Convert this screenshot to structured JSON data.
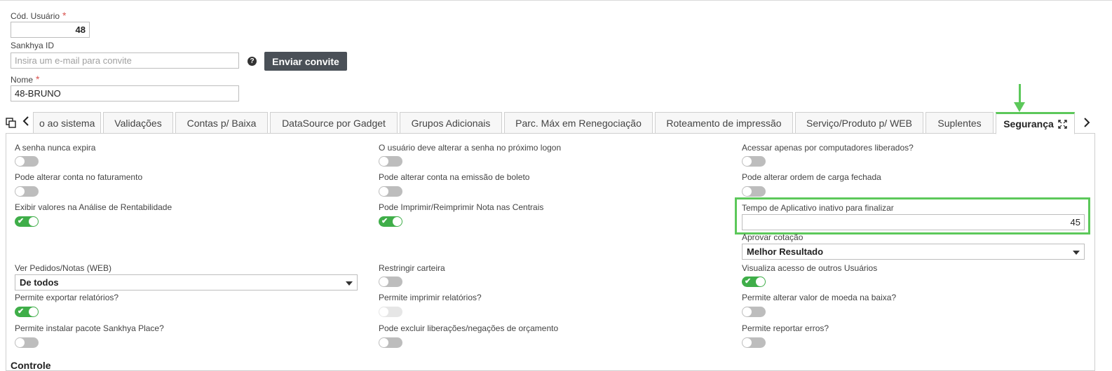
{
  "header": {
    "user_code_label": "Cód. Usuário",
    "user_code_value": "48",
    "sankhya_id_label": "Sankhya ID",
    "sankhya_id_placeholder": "Insira um e-mail para convite",
    "invite_button": "Enviar convite",
    "name_label": "Nome",
    "name_value": "48-BRUNO"
  },
  "tabs": [
    {
      "label": "Acesso ao sistema",
      "visible_text": "o ao sistema"
    },
    {
      "label": "Validações"
    },
    {
      "label": "Contas p/ Baixa"
    },
    {
      "label": "DataSource por Gadget"
    },
    {
      "label": "Grupos Adicionais"
    },
    {
      "label": "Parc. Máx em Renegociação"
    },
    {
      "label": "Roteamento de impressão"
    },
    {
      "label": "Serviço/Produto p/ WEB"
    },
    {
      "label": "Suplentes"
    },
    {
      "label": "Segurança",
      "active": true
    }
  ],
  "fields": {
    "c1r1": {
      "label": "A senha nunca expira",
      "on": false
    },
    "c2r1": {
      "label": "O usuário deve alterar a senha no próximo logon",
      "on": false
    },
    "c3r1": {
      "label": "Acessar apenas por computadores liberados?",
      "on": false
    },
    "c1r2": {
      "label": "Pode alterar conta no faturamento",
      "on": false
    },
    "c2r2": {
      "label": "Pode alterar conta na emissão de boleto",
      "on": false
    },
    "c3r2": {
      "label": "Pode alterar ordem de carga fechada",
      "on": false
    },
    "c1r3": {
      "label": "Exibir valores na Análise de Rentabilidade",
      "on": true
    },
    "c2r3": {
      "label": "Pode Imprimir/Reimprimir Nota nas Centrais",
      "on": true
    },
    "c3r3": {
      "label": "Tempo de Aplicativo inativo para finalizar",
      "value": "45"
    },
    "c3r4": {
      "label": "Aprovar cotação",
      "value": "Melhor Resultado"
    },
    "c1r5": {
      "label": "Ver Pedidos/Notas (WEB)",
      "value": "De todos"
    },
    "c2r5": {
      "label": "Restringir carteira",
      "on": false
    },
    "c3r5": {
      "label": "Visualiza acesso de outros Usuários",
      "on": true
    },
    "c1r6": {
      "label": "Permite exportar relatórios?",
      "on": true
    },
    "c2r6": {
      "label": "Permite imprimir relatórios?",
      "on": false,
      "disabled": true
    },
    "c3r6": {
      "label": "Permite alterar valor de moeda na baixa?",
      "on": false
    },
    "c1r7": {
      "label": "Permite instalar pacote Sankhya Place?",
      "on": false
    },
    "c2r7": {
      "label": "Pode excluir liberações/negações de orçamento",
      "on": false
    },
    "c3r7": {
      "label": "Permite reportar erros?",
      "on": false
    }
  },
  "section_title": "Controle",
  "colors": {
    "accent": "#5cc85a",
    "toggle_on": "#3fae49",
    "button": "#4a5057"
  },
  "icons": [
    "copy-icon",
    "chevron-left-icon",
    "chevron-right-icon",
    "expand-icon",
    "help-icon",
    "down-arrow-annotation-icon",
    "caret-down-icon"
  ]
}
